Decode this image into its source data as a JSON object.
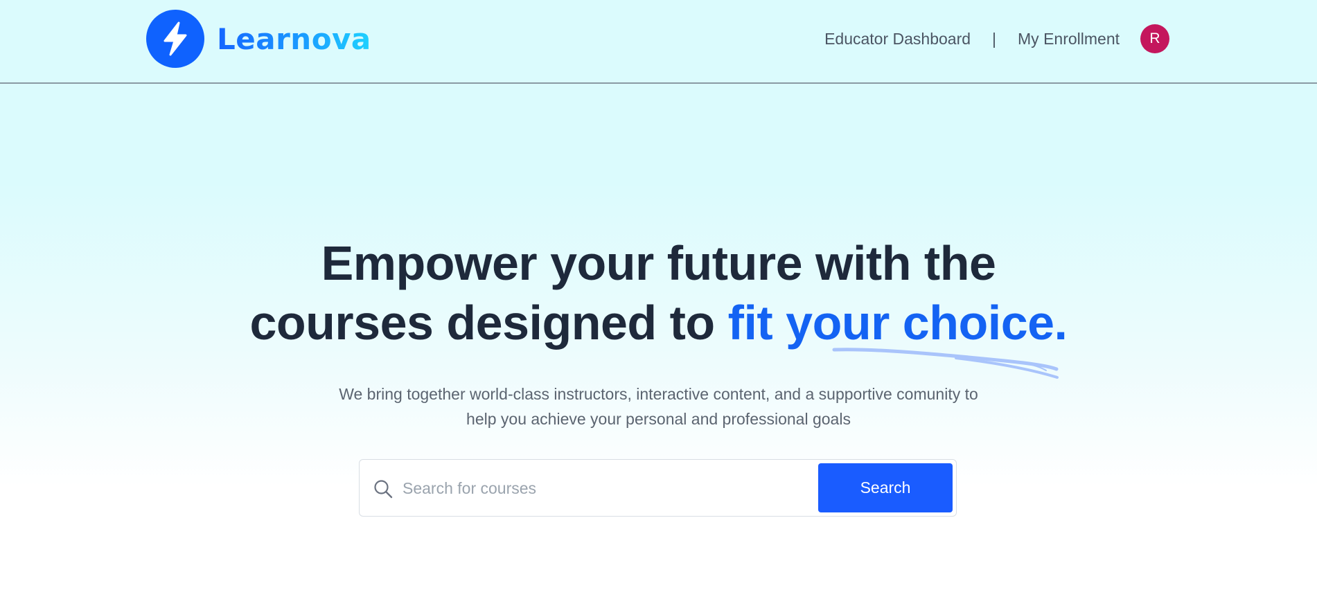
{
  "brand": {
    "name": "Learnova",
    "logo_icon": "lightning-bolt-icon",
    "primary_color": "#0f62fe"
  },
  "nav": {
    "educator_dashboard": "Educator Dashboard",
    "separator": "|",
    "my_enrollment": "My Enrollment",
    "avatar_initial": "R",
    "avatar_color": "#c4175d"
  },
  "hero": {
    "title_line1": "Empower your future with the",
    "title_line2_plain": "courses designed to ",
    "title_line2_accent": "fit your choice.",
    "subtitle_line1": "We bring together world-class instructors, interactive content, and a supportive comunity to",
    "subtitle_line2": "help you achieve your personal and professional goals",
    "accent_color": "#1463f3"
  },
  "search": {
    "placeholder": "Search for courses",
    "value": "",
    "button_label": "Search",
    "icon": "search-icon",
    "button_color": "#1a5cff"
  }
}
